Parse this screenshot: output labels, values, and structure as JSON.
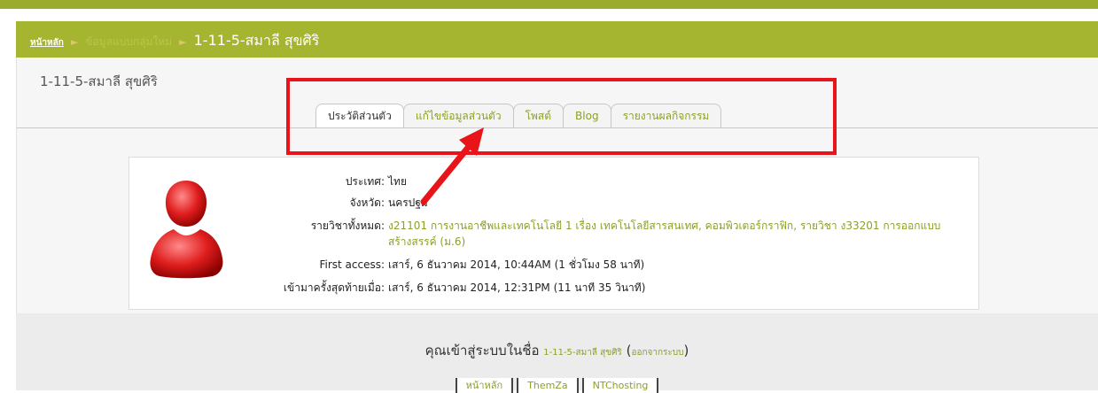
{
  "breadcrumb": {
    "home": "หน้าหลัก",
    "middle": "ข้อมูลแบบกลุ่มใหม่",
    "current": "1-11-5-สมาลี สุขศิริ"
  },
  "page_title": "1-11-5-สมาลี สุขศิริ",
  "tabs": [
    {
      "label": "ประวัติส่วนตัว",
      "active": true
    },
    {
      "label": "แก้ไขข้อมูลส่วนตัว",
      "active": false
    },
    {
      "label": "โพสต์",
      "active": false
    },
    {
      "label": "Blog",
      "active": false
    },
    {
      "label": "รายงานผลกิจกรรม",
      "active": false
    }
  ],
  "profile": {
    "avatar_icon": "user-silhouette-icon",
    "fields": [
      {
        "label": "ประเทศ:",
        "value": "ไทย",
        "link": false
      },
      {
        "label": "จังหวัด:",
        "value": "นครปฐม",
        "link": false
      },
      {
        "label": "รายวิชาทั้งหมด:",
        "value": "ง21101 การงานอาชีพและเทคโนโลยี 1 เรื่อง เทคโนโลยีสารสนเทศ, คอมพิวเตอร์กราฟิก, รายวิชา ง33201 การออกแบบสร้างสรรค์ (ม.6)",
        "link": true
      },
      {
        "label": "First access:",
        "value": "เสาร์, 6 ธันวาคม 2014, 10:44AM  (1 ชั่วโมง 58 นาที)",
        "link": false
      },
      {
        "label": "เข้ามาครั้งสุดท้ายเมื่อ:",
        "value": "เสาร์, 6 ธันวาคม 2014, 12:31PM  (11 นาที 35 วินาที)",
        "link": false
      }
    ]
  },
  "footer": {
    "login_prefix": "คุณเข้าสู่ระบบในชื่อ",
    "login_user": "1-11-5-สมาลี สุขศิริ",
    "logout": "ออกจากระบบ",
    "links": [
      "หน้าหลัก",
      "ThemZa",
      "NTChosting"
    ]
  },
  "colors": {
    "header": "#a5b52f",
    "accent_link": "#8aa12a",
    "highlight_box": "#e8141a"
  }
}
